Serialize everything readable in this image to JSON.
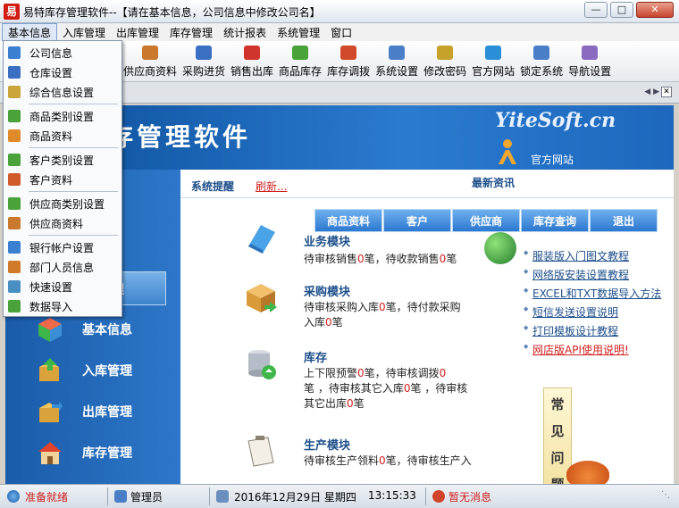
{
  "window": {
    "app_icon": "易",
    "title": "易特库存管理软件--【请在基本信息，公司信息中修改公司名】",
    "controls": [
      "minimize-icon",
      "maximize-icon",
      "close-icon"
    ]
  },
  "menubar": [
    "基本信息",
    "入库管理",
    "出库管理",
    "库存管理",
    "统计报表",
    "系统管理",
    "窗口"
  ],
  "toolbar": [
    {
      "label": "供应商资料",
      "icon": "supplier-icon",
      "color": "#c9782c"
    },
    {
      "label": "采购进货",
      "icon": "truck-icon",
      "color": "#3a6fc2"
    },
    {
      "label": "销售出库",
      "icon": "cart-icon",
      "color": "#d0342c"
    },
    {
      "label": "商品库存",
      "icon": "boxes-icon",
      "color": "#4aa23a"
    },
    {
      "label": "库存调拨",
      "icon": "transfer-icon",
      "color": "#d04a2a"
    },
    {
      "label": "系统设置",
      "icon": "settings-icon",
      "color": "#4a7fc7"
    },
    {
      "label": "修改密码",
      "icon": "key-icon",
      "color": "#c7a22b"
    },
    {
      "label": "官方网站",
      "icon": "ie-icon",
      "color": "#2a8fd6"
    },
    {
      "label": "锁定系统",
      "icon": "lock-monitor-icon",
      "color": "#4a7fc7"
    },
    {
      "label": "导航设置",
      "icon": "nav-icon",
      "color": "#8a6abf"
    }
  ],
  "basic_menu": [
    {
      "label": "公司信息",
      "icon": "company-icon",
      "color": "#3a7fd0"
    },
    {
      "label": "仓库设置",
      "icon": "warehouse-icon",
      "color": "#3a6fc2"
    },
    {
      "label": "综合信息设置",
      "icon": "gear-icon",
      "color": "#c9a53a"
    },
    {
      "label": "商品类别设置",
      "icon": "grid-icon",
      "color": "#4aa23a"
    },
    {
      "label": "商品资料",
      "icon": "product-icon",
      "color": "#e08a2a"
    },
    {
      "label": "客户类别设置",
      "icon": "grid-icon",
      "color": "#4aa23a"
    },
    {
      "label": "客户资料",
      "icon": "customer-icon",
      "color": "#d05a2a"
    },
    {
      "label": "供应商类别设置",
      "icon": "grid-icon",
      "color": "#4aa23a"
    },
    {
      "label": "供应商资料",
      "icon": "supplier-icon",
      "color": "#c9782c"
    },
    {
      "label": "银行帐户设置",
      "icon": "bank-icon",
      "color": "#3a7fd0"
    },
    {
      "label": "部门人员信息",
      "icon": "people-icon",
      "color": "#d07a2a"
    },
    {
      "label": "快速设置",
      "icon": "quick-icon",
      "color": "#4a8fc2"
    },
    {
      "label": "数据导入",
      "icon": "import-icon",
      "color": "#4aa23a"
    }
  ],
  "banner": {
    "title": "存管理软件",
    "site": "YiteSoft.cn",
    "site_link": "官方网站"
  },
  "leftnav": {
    "highlight": "理",
    "items": [
      {
        "label": "基本信息",
        "icon": "cube-icon"
      },
      {
        "label": "入库管理",
        "icon": "stock-in-icon"
      },
      {
        "label": "出库管理",
        "icon": "stock-out-icon"
      },
      {
        "label": "库存管理",
        "icon": "house-icon"
      }
    ]
  },
  "content": {
    "sys_remind": "系统提醒",
    "refresh": "刷新...",
    "news_title": "最新资讯",
    "quick_buttons": [
      "商品资料",
      "客户",
      "供应商",
      "库存查询",
      "退出"
    ],
    "modules": [
      {
        "title": "业务模块",
        "lines": [
          [
            "待审核销售",
            "0",
            "笔，待收款销售",
            "0",
            "笔"
          ]
        ]
      },
      {
        "title": "采购模块",
        "lines": [
          [
            "待审核采购入库",
            "0",
            "笔，待付款采购",
            "",
            ""
          ],
          [
            "入库",
            "0",
            "笔",
            "",
            ""
          ]
        ]
      },
      {
        "title": "库存",
        "lines": [
          [
            "上下限预警",
            "0",
            "笔，待审核调拨",
            "0",
            ""
          ],
          [
            "笔 ，待审核其它入库",
            "0",
            "笔 ，待审核",
            "",
            ""
          ],
          [
            "其它出库",
            "0",
            "笔",
            "",
            ""
          ]
        ]
      },
      {
        "title": "生产模块",
        "lines": [
          [
            "待审核生产领料",
            "0",
            "笔，待审核生产入",
            "",
            ""
          ]
        ]
      }
    ],
    "links": [
      {
        "text": "服装版入门图文教程",
        "red": false
      },
      {
        "text": "网络版安装设置教程",
        "red": false
      },
      {
        "text": "EXCEL和TXT数据导入方法",
        "red": false
      },
      {
        "text": "短信发送设置说明",
        "red": false
      },
      {
        "text": "打印模板设计教程",
        "red": false
      },
      {
        "text": "网店版API使用说明!",
        "red": true
      }
    ],
    "faq": [
      "常",
      "见",
      "问",
      "题"
    ]
  },
  "statusbar": {
    "ready": "准备就绪",
    "user": "管理员",
    "date": "2016年12月29日 星期四",
    "time": "13:15:33",
    "message": "暂无消息"
  }
}
